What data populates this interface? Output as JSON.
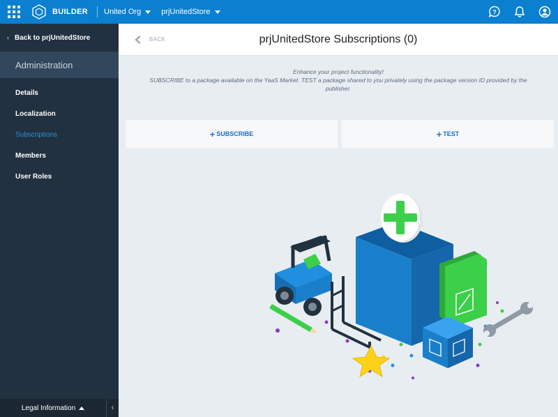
{
  "topbar": {
    "app_label": "BUILDER",
    "org": "United Org",
    "project": "prjUnitedStore",
    "icons": [
      "apps-grid-icon",
      "builder-logo-icon",
      "help-icon",
      "bell-icon",
      "user-icon"
    ]
  },
  "sidebar": {
    "back_label": "Back to prjUnitedStore",
    "section_title": "Administration",
    "items": [
      {
        "label": "Details"
      },
      {
        "label": "Localization"
      },
      {
        "label": "Subscriptions"
      },
      {
        "label": "Members"
      },
      {
        "label": "User Roles"
      }
    ],
    "active_item": "Subscriptions",
    "footer_label": "Legal Information"
  },
  "main": {
    "back_label": "BACK",
    "title": "prjUnitedStore Subscriptions (0)",
    "intro_line1": "Enhance your project functionality!",
    "intro_line2": "SUBSCRIBE to a package available on the YaaS Market. TEST a package shared to you privately using the package version ID provided by the publisher.",
    "subscribe_label": "SUBSCRIBE",
    "test_label": "TEST"
  },
  "colors": {
    "topbar": "#0b7fd0",
    "sidebar": "#22313f",
    "sidebar_section": "#32475c",
    "active_link": "#2d8fe0",
    "action_text": "#1a6fc9",
    "background": "#e8edf2"
  }
}
